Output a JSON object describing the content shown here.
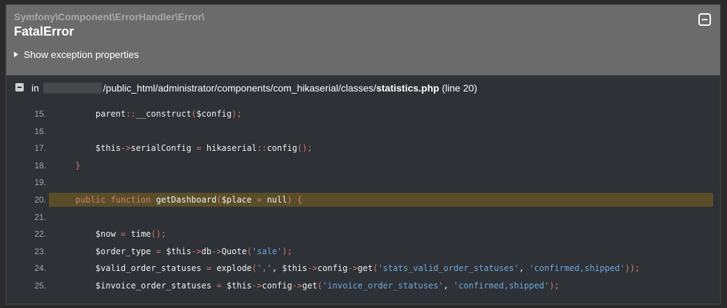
{
  "exception": {
    "class": "Symfony\\Component\\ErrorHandler\\Error\\",
    "title": "FatalError",
    "show_properties_label": "Show exception properties"
  },
  "trace": {
    "in_label": "in",
    "path_middle": "/public_html/administrator/components/com_hikaserial/classes/",
    "file_name": "statistics.php",
    "line_info": "(line 20)"
  },
  "code": {
    "highlighted_line": "20.",
    "lines": [
      {
        "num": "15.",
        "indent": "    ",
        "tokens": [
          [
            "t",
            "parent"
          ],
          [
            "o",
            "::"
          ],
          [
            "t",
            "__construct"
          ],
          [
            "o",
            "("
          ],
          [
            "t",
            "$config"
          ],
          [
            "o",
            ");"
          ]
        ]
      },
      {
        "num": "16.",
        "indent": "",
        "tokens": []
      },
      {
        "num": "17.",
        "indent": "    ",
        "tokens": [
          [
            "t",
            "$this"
          ],
          [
            "o",
            "->"
          ],
          [
            "t",
            "serialConfig "
          ],
          [
            "o",
            "="
          ],
          [
            "t",
            " hikaserial"
          ],
          [
            "o",
            "::"
          ],
          [
            "t",
            "config"
          ],
          [
            "o",
            "();"
          ]
        ]
      },
      {
        "num": "18.",
        "indent": "",
        "tokens": [
          [
            "o",
            "}"
          ]
        ]
      },
      {
        "num": "19.",
        "indent": "",
        "tokens": []
      },
      {
        "num": "20.",
        "indent": "",
        "tokens": [
          [
            "o",
            "public function "
          ],
          [
            "t",
            "getDashboard"
          ],
          [
            "o",
            "("
          ],
          [
            "t",
            "$place "
          ],
          [
            "o",
            "="
          ],
          [
            "t",
            " null"
          ],
          [
            "o",
            ") {"
          ]
        ]
      },
      {
        "num": "21.",
        "indent": "",
        "tokens": []
      },
      {
        "num": "22.",
        "indent": "    ",
        "tokens": [
          [
            "t",
            "$now "
          ],
          [
            "o",
            "="
          ],
          [
            "t",
            " time"
          ],
          [
            "o",
            "();"
          ]
        ]
      },
      {
        "num": "23.",
        "indent": "    ",
        "tokens": [
          [
            "t",
            "$order_type "
          ],
          [
            "o",
            "="
          ],
          [
            "t",
            " $this"
          ],
          [
            "o",
            "->"
          ],
          [
            "t",
            "db"
          ],
          [
            "o",
            "->"
          ],
          [
            "t",
            "Quote"
          ],
          [
            "o",
            "("
          ],
          [
            "s",
            "'sale'"
          ],
          [
            "o",
            ");"
          ]
        ]
      },
      {
        "num": "24.",
        "indent": "    ",
        "tokens": [
          [
            "t",
            "$valid_order_statuses "
          ],
          [
            "o",
            "="
          ],
          [
            "t",
            " explode"
          ],
          [
            "o",
            "("
          ],
          [
            "s",
            "','"
          ],
          [
            "t",
            ", $this"
          ],
          [
            "o",
            "->"
          ],
          [
            "t",
            "config"
          ],
          [
            "o",
            "->"
          ],
          [
            "t",
            "get"
          ],
          [
            "o",
            "("
          ],
          [
            "s",
            "'stats_valid_order_statuses'"
          ],
          [
            "t",
            ", "
          ],
          [
            "s",
            "'confirmed,shipped'"
          ],
          [
            "o",
            "));"
          ]
        ]
      },
      {
        "num": "25.",
        "indent": "    ",
        "tokens": [
          [
            "t",
            "$invoice_order_statuses "
          ],
          [
            "o",
            "="
          ],
          [
            "t",
            " $this"
          ],
          [
            "o",
            "->"
          ],
          [
            "t",
            "config"
          ],
          [
            "o",
            "->"
          ],
          [
            "t",
            "get"
          ],
          [
            "o",
            "("
          ],
          [
            "s",
            "'invoice_order_statuses'"
          ],
          [
            "t",
            ", "
          ],
          [
            "s",
            "'confirmed,shipped'"
          ],
          [
            "o",
            ");"
          ]
        ]
      }
    ]
  },
  "icons": {
    "collapse": "minus-square-icon",
    "expand_triangle": "triangle-right-icon"
  },
  "colors": {
    "operator": "#d07d6a",
    "string": "#6fa8dc",
    "highlight": "#5a4e28"
  }
}
